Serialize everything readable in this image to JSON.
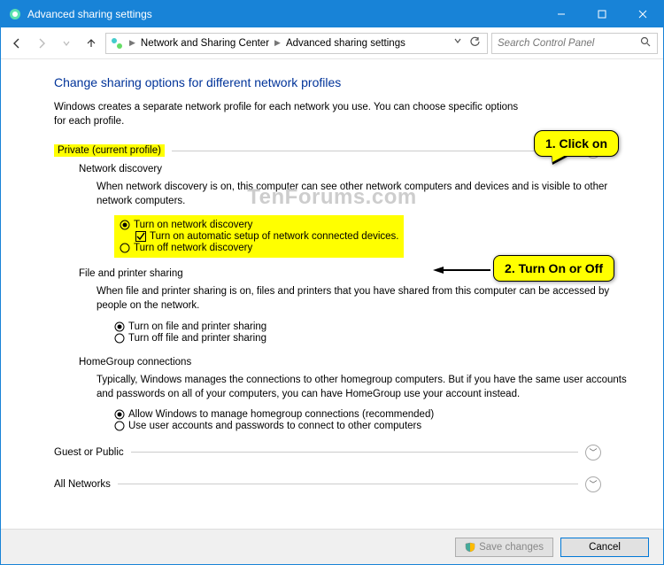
{
  "window": {
    "title": "Advanced sharing settings"
  },
  "nav": {
    "breadcrumb": {
      "parent": "Network and Sharing Center",
      "current": "Advanced sharing settings"
    },
    "search_placeholder": "Search Control Panel"
  },
  "page": {
    "title": "Change sharing options for different network profiles",
    "desc": "Windows creates a separate network profile for each network you use. You can choose specific options for each profile."
  },
  "sections": {
    "private": {
      "label": "Private (current profile)",
      "network_discovery": {
        "title": "Network discovery",
        "desc": "When network discovery is on, this computer can see other network computers and devices and is visible to other network computers.",
        "opt_on": "Turn on network discovery",
        "opt_auto": "Turn on automatic setup of network connected devices.",
        "opt_off": "Turn off network discovery"
      },
      "file_printer": {
        "title": "File and printer sharing",
        "desc": "When file and printer sharing is on, files and printers that you have shared from this computer can be accessed by people on the network.",
        "opt_on": "Turn on file and printer sharing",
        "opt_off": "Turn off file and printer sharing"
      },
      "homegroup": {
        "title": "HomeGroup connections",
        "desc": "Typically, Windows manages the connections to other homegroup computers. But if you have the same user accounts and passwords on all of your computers, you can have HomeGroup use your account instead.",
        "opt_allow": "Allow Windows to manage homegroup connections (recommended)",
        "opt_user": "Use user accounts and passwords to connect to other computers"
      }
    },
    "guest": {
      "label": "Guest or Public"
    },
    "all": {
      "label": "All Networks"
    }
  },
  "buttons": {
    "save": "Save changes",
    "cancel": "Cancel"
  },
  "callouts": {
    "c1": "1. Click on",
    "c2": "2. Turn On or Off"
  },
  "watermark": "TenForums.com"
}
